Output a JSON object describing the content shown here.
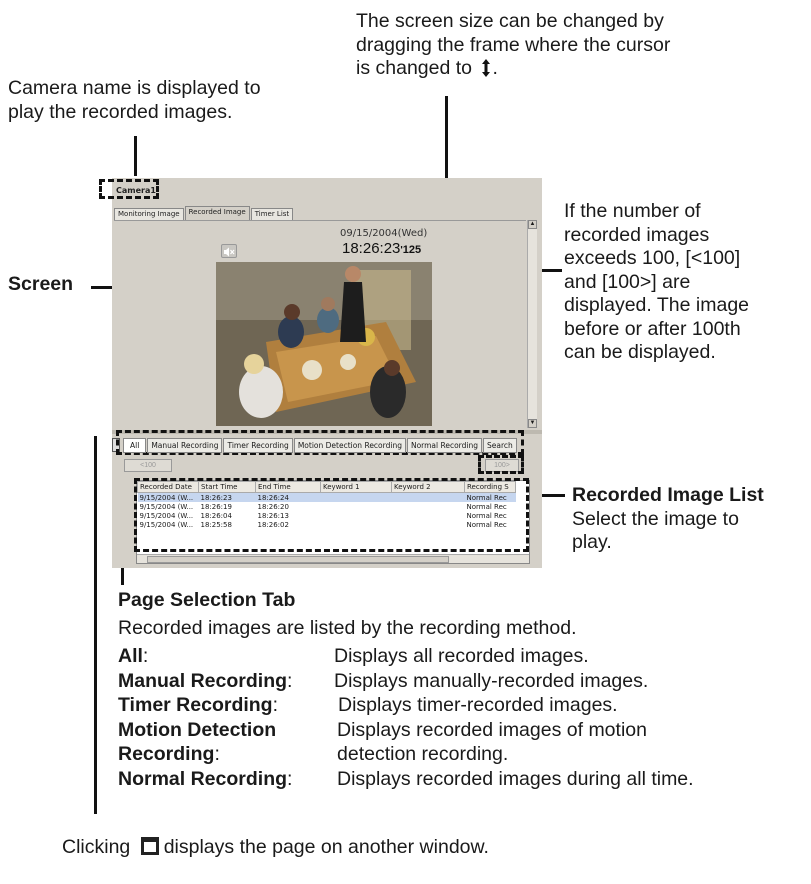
{
  "annotations": {
    "camera_name": [
      "Camera name is displayed to",
      "play the recorded images."
    ],
    "screen_size": [
      "The screen size can be changed by",
      "dragging the frame where the cursor",
      "is changed to"
    ],
    "screen_size_end": ".",
    "screen_label": "Screen",
    "hundred": [
      "If the number of",
      "recorded images",
      "exceeds 100, [<100]",
      "and [100>] are",
      "displayed. The image",
      "before or after 100th",
      "can be displayed."
    ],
    "list_title": "Recorded Image List",
    "list_desc": [
      "Select the image to",
      "play."
    ],
    "page_tab_title": "Page Selection Tab",
    "page_tab_desc": "Recorded images are listed by the recording method.",
    "defs": [
      {
        "term": "All",
        "sep": ":",
        "desc": "Displays all recorded images."
      },
      {
        "term": "Manual Recording",
        "sep": ":",
        "desc": "Displays manually-recorded images."
      },
      {
        "term": "Timer Recording",
        "sep": ":",
        "desc": "Displays timer-recorded images."
      },
      {
        "term": "Motion Detection",
        "sep": "",
        "desc": "Displays recorded images of motion"
      },
      {
        "term": "Recording",
        "sep": ":",
        "desc": "detection recording."
      },
      {
        "term": "Normal Recording",
        "sep": ":",
        "desc": "Displays recorded images during all time."
      }
    ],
    "bottom_pre": "Clicking",
    "bottom_post": "displays the page on another window."
  },
  "app": {
    "camera_name": "Camera1",
    "top_tabs": [
      "Monitoring Image",
      "Recorded Image",
      "Timer List"
    ],
    "date": "09/15/2004(Wed)",
    "time": "18:26:23",
    "time_ms": "125",
    "page_tabs": [
      "All",
      "Manual Recording",
      "Timer Recording",
      "Motion Detection Recording",
      "Normal Recording",
      "Search"
    ],
    "prev_button": "<100",
    "next_button": "100>",
    "columns": [
      "Recorded Date",
      "Start Time",
      "End Time",
      "Keyword 1",
      "Keyword 2",
      "Recording S"
    ],
    "rows": [
      [
        "9/15/2004 (W...",
        "18:26:23",
        "18:26:24",
        "",
        "",
        "Normal Rec"
      ],
      [
        "9/15/2004 (W...",
        "18:26:19",
        "18:26:20",
        "",
        "",
        "Normal Rec"
      ],
      [
        "9/15/2004 (W...",
        "18:26:04",
        "18:26:13",
        "",
        "",
        "Normal Rec"
      ],
      [
        "9/15/2004 (W...",
        "18:25:58",
        "18:26:02",
        "",
        "",
        "Normal Rec"
      ]
    ]
  }
}
